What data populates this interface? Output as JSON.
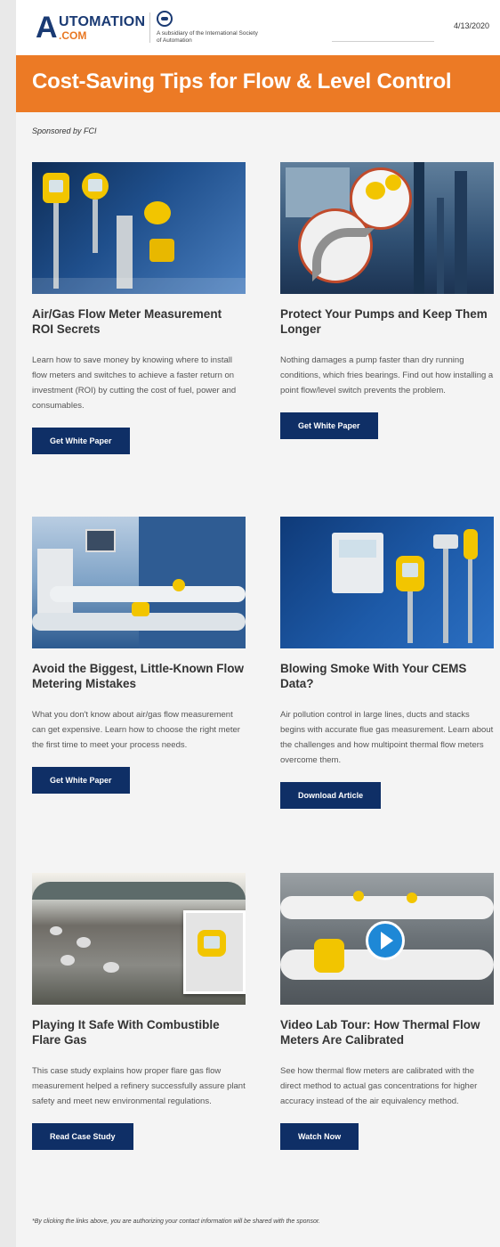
{
  "header": {
    "logo_letter": "A",
    "logo_top": "UTOMATION",
    "logo_bottom": ".COM",
    "isa_caption": "A subsidiary of the International Society of Automation",
    "date": "4/13/2020"
  },
  "banner": {
    "title": "Cost-Saving Tips for Flow & Level Control"
  },
  "sponsor": {
    "text": "Sponsored by FCI"
  },
  "cards": [
    {
      "title": "Air/Gas Flow Meter Measurement ROI Secrets",
      "description": "Learn how to save money by knowing where to install flow meters and switches to achieve a faster return on investment (ROI) by cutting the cost of fuel, power and consumables.",
      "button": "Get White Paper",
      "image_icon": "flow-meters-product-image"
    },
    {
      "title": "Protect Your Pumps and Keep Them Longer",
      "description": "Nothing damages a pump faster than dry running conditions, which fries bearings. Find out how installing a point flow/level switch prevents the problem.",
      "button": "Get White Paper",
      "image_icon": "refinery-pump-image"
    },
    {
      "title": "Avoid the Biggest, Little-Known Flow Metering Mistakes",
      "description": "What you don't know about air/gas flow measurement can get expensive. Learn how to choose the right meter the first time to meet your process needs.",
      "button": "Get White Paper",
      "image_icon": "industrial-piping-image"
    },
    {
      "title": "Blowing Smoke With Your CEMS Data?",
      "description": "Air pollution control in large lines, ducts and stacks begins with accurate flue gas measurement. Learn about the challenges and how multipoint thermal flow meters overcome them.",
      "button": "Download Article",
      "image_icon": "cems-meters-image"
    },
    {
      "title": "Playing It Safe With Combustible Flare Gas",
      "description": "This case study explains how proper flare gas flow measurement helped a refinery successfully assure plant safety and meet new environmental regulations.",
      "button": "Read Case Study",
      "image_icon": "refinery-aerial-image"
    },
    {
      "title": "Video Lab Tour: How Thermal Flow Meters Are Calibrated",
      "description": "See how thermal flow meters are calibrated with the direct method to actual gas concentrations for higher accuracy instead of the air equivalency method.",
      "button": "Watch Now",
      "image_icon": "video-lab-image"
    }
  ],
  "footer": {
    "note": "*By clicking the links above, you are authorizing your contact information will be shared with the sponsor."
  },
  "colors": {
    "orange": "#ec7a25",
    "navy": "#0f2f66",
    "text": "#333333"
  }
}
